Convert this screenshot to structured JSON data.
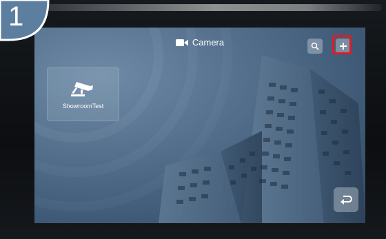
{
  "step": {
    "number": "1"
  },
  "header": {
    "title": "Camera",
    "title_icon": "video-camera-icon"
  },
  "toolbar": {
    "search_icon": "search-icon",
    "add_icon": "plus-icon",
    "highlight_color": "#e11a22"
  },
  "devices": [
    {
      "name": "ShowroomTest",
      "icon": "security-camera-icon"
    }
  ],
  "footer": {
    "back_icon": "return-arrow-icon"
  },
  "colors": {
    "screen_bg": "#4f6a86",
    "accent_highlight": "#e11a22"
  }
}
